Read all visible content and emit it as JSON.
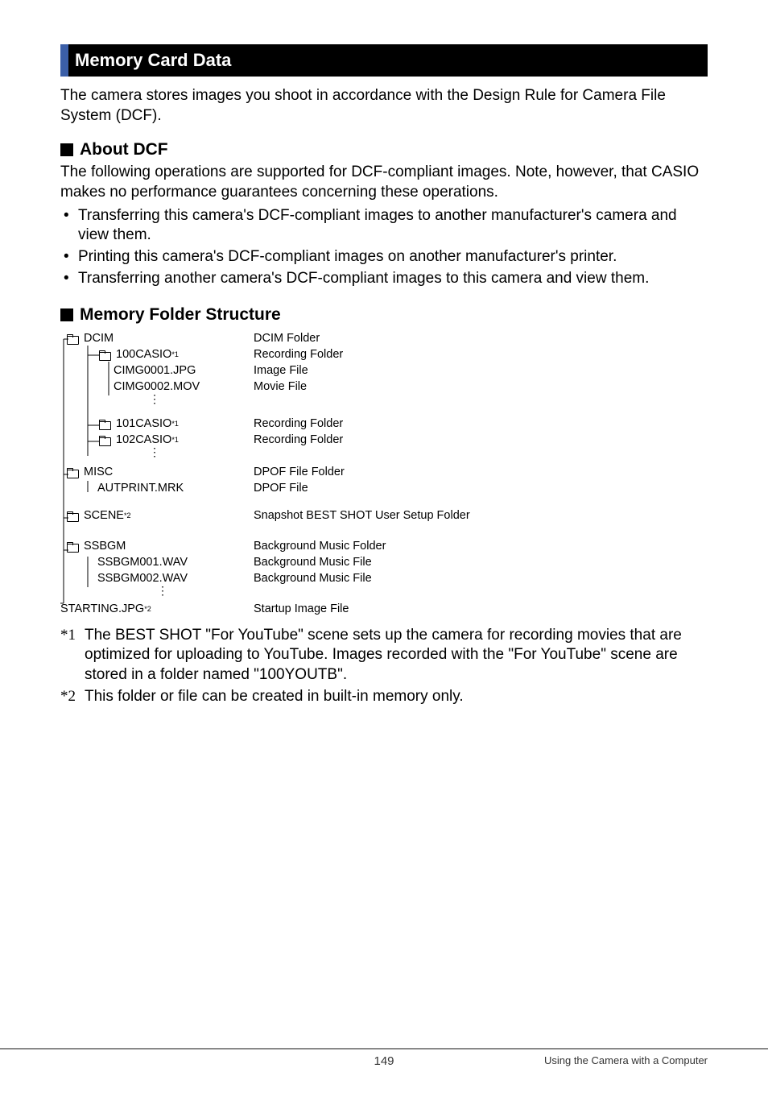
{
  "section_header": "Memory Card Data",
  "intro": "The camera stores images you shoot in accordance with the Design Rule for Camera File System (DCF).",
  "about_dcf_heading": "About DCF",
  "about_dcf_text": "The following operations are supported for DCF-compliant images. Note, however, that CASIO makes no performance guarantees concerning these operations.",
  "bullets": [
    "Transferring this camera's DCF-compliant images to another manufacturer's camera and view them.",
    "Printing this camera's DCF-compliant images on another manufacturer's printer.",
    "Transferring another camera's DCF-compliant images to this camera and view them."
  ],
  "mfs_heading": "Memory Folder Structure",
  "tree": {
    "dcim": {
      "name": "DCIM",
      "desc": "DCIM Folder"
    },
    "f100": {
      "name": "100CASIO ",
      "sup": "*1",
      "desc": "Recording Folder"
    },
    "cimg1": {
      "name": "CIMG0001.JPG",
      "desc": "Image File"
    },
    "cimg2": {
      "name": "CIMG0002.MOV",
      "desc": "Movie File"
    },
    "f101": {
      "name": "101CASIO ",
      "sup": "*1",
      "desc": "Recording Folder"
    },
    "f102": {
      "name": "102CASIO ",
      "sup": "*1",
      "desc": "Recording Folder"
    },
    "misc": {
      "name": "MISC",
      "desc": "DPOF File Folder"
    },
    "autprint": {
      "name": "AUTPRINT.MRK",
      "desc": "DPOF File"
    },
    "scene": {
      "name": "SCENE ",
      "sup": "*2",
      "desc": "Snapshot BEST SHOT User Setup Folder"
    },
    "ssbgm": {
      "name": "SSBGM",
      "desc": "Background Music Folder"
    },
    "ssbgm1": {
      "name": "SSBGM001.WAV",
      "desc": "Background Music File"
    },
    "ssbgm2": {
      "name": "SSBGM002.WAV",
      "desc": "Background Music File"
    },
    "starting": {
      "name": "STARTING.JPG ",
      "sup": "*2",
      "desc": "Startup Image File"
    }
  },
  "footnotes": {
    "f1_mark": "*1",
    "f1": "The BEST SHOT \"For YouTube\" scene sets up the camera for recording movies that are optimized for uploading to YouTube. Images recorded with the \"For YouTube\" scene are stored in a folder named \"100YOUTB\".",
    "f2_mark": "*2",
    "f2": "This folder or file can be created in built-in memory only."
  },
  "page_number": "149",
  "footer_text": "Using the Camera with a Computer"
}
